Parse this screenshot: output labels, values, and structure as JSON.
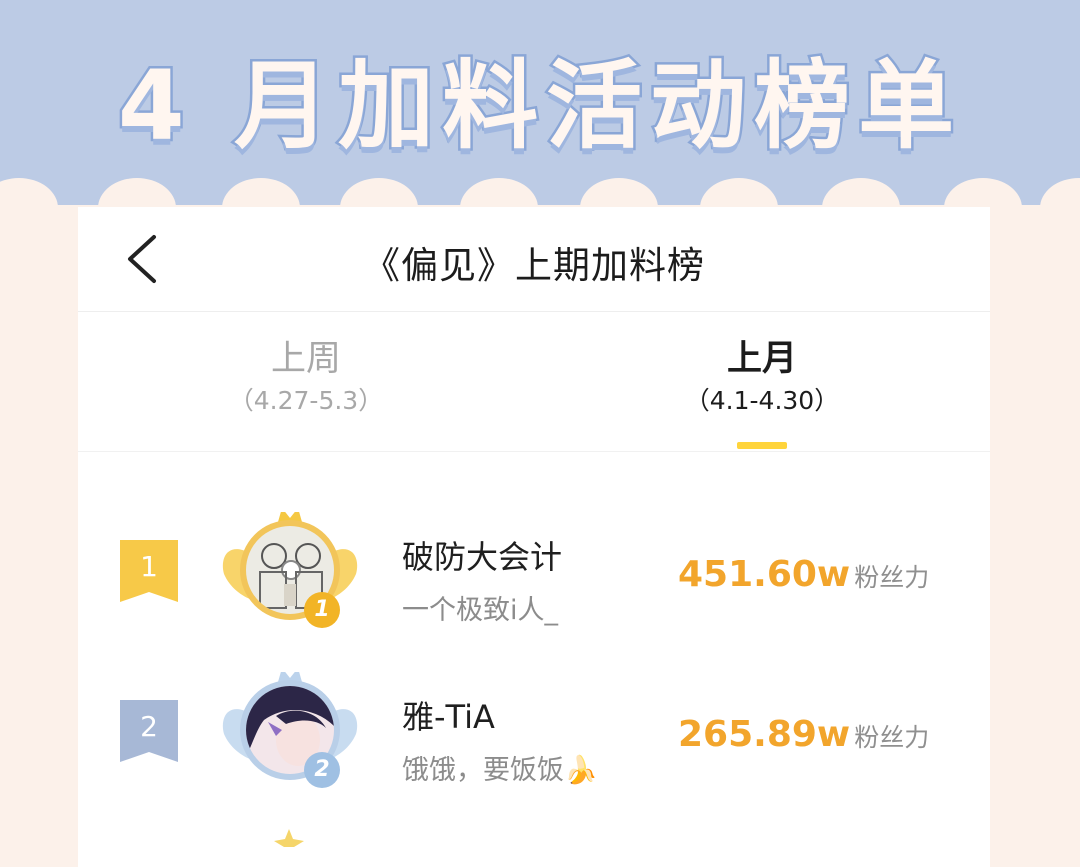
{
  "banner": {
    "title": "4 月加料活动榜单"
  },
  "header": {
    "title": "《偏见》上期加料榜"
  },
  "tabs": [
    {
      "label": "上周",
      "range": "（4.27-5.3）",
      "active": false
    },
    {
      "label": "上月",
      "range": "（4.1-4.30）",
      "active": true
    }
  ],
  "leaderboard": [
    {
      "rank": "1",
      "medal": "1",
      "name": "破防大会计",
      "signature": "一个极致i人_",
      "power_value": "451.60w",
      "power_unit": "粉丝力",
      "badge_color": "#f7c948",
      "medal_color": "#f2b426",
      "wing_color": "#f8d46a"
    },
    {
      "rank": "2",
      "medal": "2",
      "name": "雅-TiA",
      "signature": "饿饿，要饭饭🍌",
      "power_value": "265.89w",
      "power_unit": "粉丝力",
      "badge_color": "#a7b8d6",
      "medal_color": "#9fc0e3",
      "wing_color": "#c8dcf0"
    }
  ],
  "colors": {
    "banner_bg": "#bccbe5",
    "page_bg": "#fcf1ea",
    "accent_yellow": "#ffd43b",
    "power_orange": "#f2a52c"
  },
  "icons": {
    "back": "chevron-left-icon",
    "crown": "crown-icon",
    "wings": "wings-icon"
  }
}
